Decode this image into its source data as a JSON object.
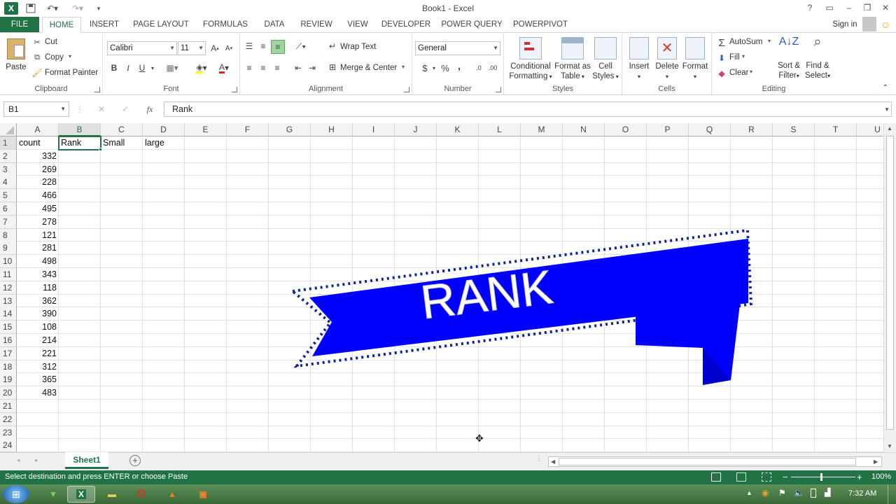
{
  "window": {
    "title": "Book1 - Excel",
    "sign_in": "Sign in"
  },
  "tabs": [
    "FILE",
    "HOME",
    "INSERT",
    "PAGE LAYOUT",
    "FORMULAS",
    "DATA",
    "REVIEW",
    "VIEW",
    "DEVELOPER",
    "POWER QUERY",
    "POWERPIVOT"
  ],
  "ribbon": {
    "clipboard": {
      "paste": "Paste",
      "cut": "Cut",
      "copy": "Copy",
      "format_painter": "Format Painter",
      "label": "Clipboard"
    },
    "font": {
      "name": "Calibri",
      "size": "11",
      "bold": "B",
      "italic": "I",
      "underline": "U",
      "label": "Font"
    },
    "alignment": {
      "wrap": "Wrap Text",
      "merge": "Merge & Center",
      "label": "Alignment"
    },
    "number": {
      "format": "General",
      "currency": "$",
      "percent": "%",
      "comma": ",",
      "label": "Number"
    },
    "styles": {
      "conditional": [
        "Conditional",
        "Formatting"
      ],
      "format_table": [
        "Format as",
        "Table"
      ],
      "cell_styles": [
        "Cell",
        "Styles"
      ],
      "label": "Styles"
    },
    "cells": {
      "insert": "Insert",
      "delete": "Delete",
      "format": "Format",
      "label": "Cells"
    },
    "editing": {
      "autosum": "AutoSum",
      "fill": "Fill",
      "clear": "Clear",
      "sort": [
        "Sort &",
        "Filter"
      ],
      "find": [
        "Find &",
        "Select"
      ],
      "label": "Editing"
    }
  },
  "formula_bar": {
    "name_box": "B1",
    "fx": "fx",
    "value": "Rank"
  },
  "columns": [
    "A",
    "B",
    "C",
    "D",
    "E",
    "F",
    "G",
    "H",
    "I",
    "J",
    "K",
    "L",
    "M",
    "N",
    "O",
    "P",
    "Q",
    "R",
    "S",
    "T",
    "U"
  ],
  "rows": [
    "1",
    "2",
    "3",
    "4",
    "5",
    "6",
    "7",
    "8",
    "9",
    "10",
    "11",
    "12",
    "13",
    "14",
    "15",
    "16",
    "17",
    "18",
    "19",
    "20",
    "21",
    "22",
    "23",
    "24"
  ],
  "headers_row": {
    "A": "count",
    "B": "Rank",
    "C": "Small",
    "D": "large"
  },
  "count_values": [
    "332",
    "269",
    "228",
    "466",
    "495",
    "278",
    "121",
    "281",
    "498",
    "343",
    "118",
    "362",
    "390",
    "108",
    "214",
    "221",
    "312",
    "365",
    "483"
  ],
  "banner": {
    "text": "RANK",
    "color": "#0000ff"
  },
  "sheet_tab": "Sheet1",
  "status": {
    "message": "Select destination and press ENTER or choose Paste",
    "zoom": "100%"
  },
  "taskbar": {
    "time": "7:32 AM"
  }
}
